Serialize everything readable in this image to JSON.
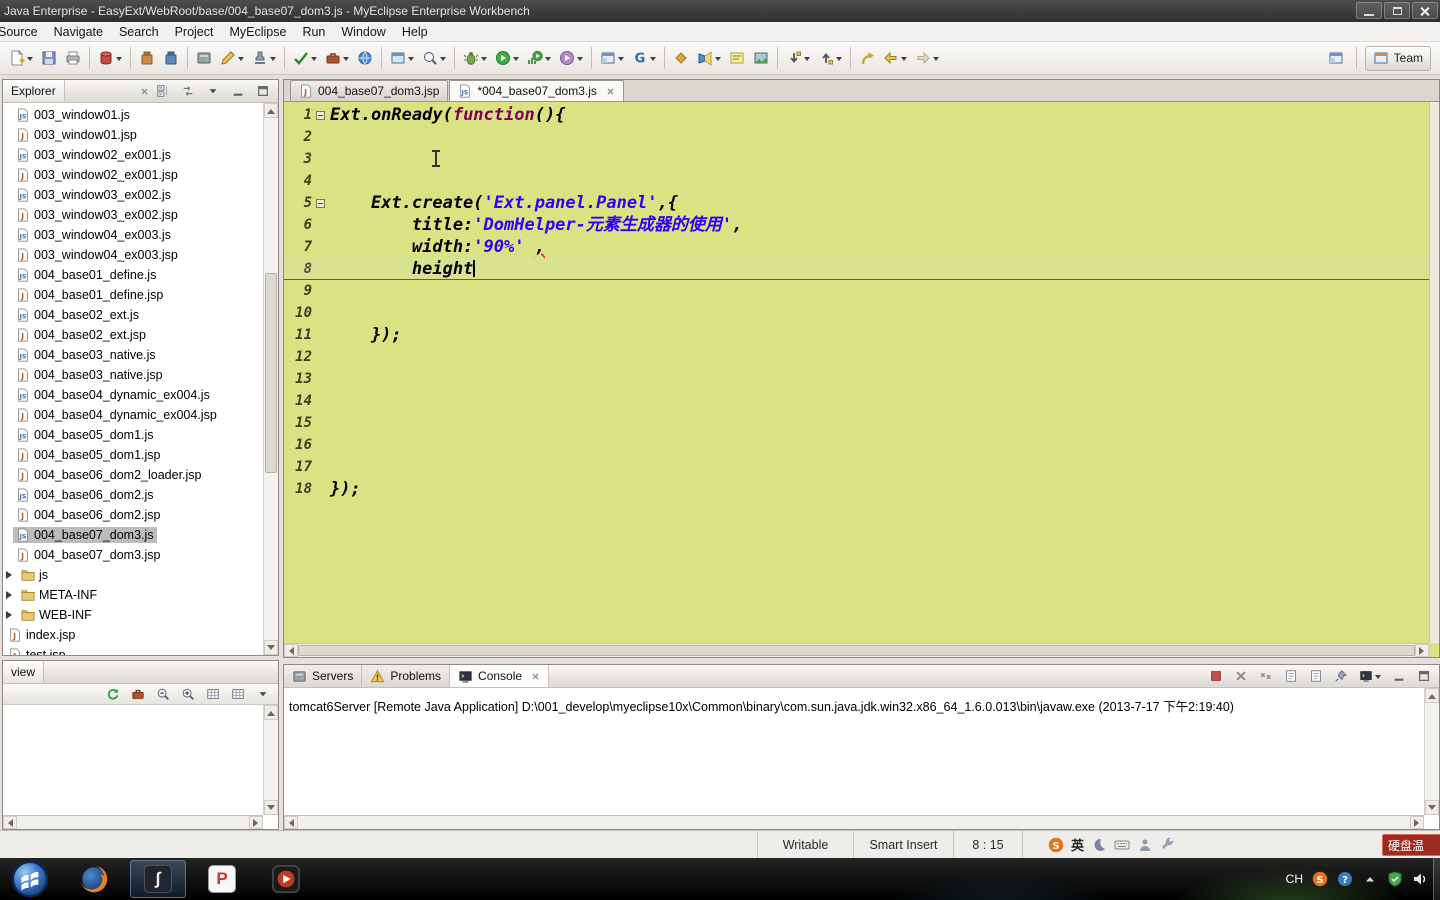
{
  "window": {
    "title": "Java Enterprise - EasyExt/WebRoot/base/004_base07_dom3.js - MyEclipse Enterprise Workbench"
  },
  "menu": {
    "items": [
      "Source",
      "Navigate",
      "Search",
      "Project",
      "MyEclipse",
      "Run",
      "Window",
      "Help"
    ]
  },
  "toolbar": {
    "perspective": {
      "team": "Team"
    },
    "groups": [
      {
        "items": [
          {
            "name": "new-wizard",
            "icon": "new",
            "dd": true
          },
          {
            "name": "save",
            "icon": "save"
          },
          {
            "name": "print",
            "icon": "print"
          }
        ]
      },
      {
        "items": [
          {
            "name": "database",
            "icon": "db",
            "dd": true
          }
        ]
      },
      {
        "items": [
          {
            "name": "deploy-jar",
            "icon": "jar"
          },
          {
            "name": "deploy-war",
            "icon": "war"
          }
        ]
      },
      {
        "items": [
          {
            "name": "run-server",
            "icon": "server"
          },
          {
            "name": "editor-pencil",
            "icon": "pencil",
            "dd": true
          },
          {
            "name": "signature",
            "icon": "stamp",
            "dd": true
          }
        ]
      },
      {
        "items": [
          {
            "name": "validate",
            "icon": "check",
            "dd": true
          },
          {
            "name": "external-tools",
            "icon": "tools",
            "dd": true
          },
          {
            "name": "web-browser",
            "icon": "globe"
          }
        ]
      },
      {
        "items": [
          {
            "name": "new-window-wizard",
            "icon": "window",
            "dd": true
          },
          {
            "name": "search-menu",
            "icon": "mag",
            "dd": true
          }
        ]
      },
      {
        "items": [
          {
            "name": "debug",
            "icon": "bug",
            "dd": true
          },
          {
            "name": "run",
            "icon": "run",
            "dd": true
          },
          {
            "name": "coverage",
            "icon": "cov",
            "dd": true
          },
          {
            "name": "profile",
            "icon": "prof",
            "dd": true
          }
        ]
      },
      {
        "items": [
          {
            "name": "new-web-project",
            "icon": "persp",
            "dd": true
          },
          {
            "name": "gwt-compile",
            "icon": "G",
            "dd": true
          }
        ]
      },
      {
        "items": [
          {
            "name": "open-type",
            "icon": "diamond"
          },
          {
            "name": "search-torch",
            "icon": "torch",
            "dd": true
          },
          {
            "name": "mark-occurrences",
            "icon": "occ"
          },
          {
            "name": "image-preview",
            "icon": "image"
          }
        ]
      },
      {
        "items": [
          {
            "name": "next-annotation",
            "icon": "an-next",
            "dd": true
          },
          {
            "name": "previous-annotation",
            "icon": "an-prev",
            "dd": true
          }
        ]
      },
      {
        "items": [
          {
            "name": "last-edit-location",
            "icon": "editloc"
          },
          {
            "name": "back",
            "icon": "back",
            "dd": true
          },
          {
            "name": "forward",
            "icon": "fwd",
            "dd": true
          }
        ]
      }
    ]
  },
  "explorer": {
    "title": "Explorer",
    "header_icons": [
      {
        "name": "collapse-all",
        "icon": "collapse"
      },
      {
        "name": "link-with-editor",
        "icon": "link"
      },
      {
        "name": "view-menu",
        "icon": "dd"
      },
      {
        "name": "minimize",
        "icon": "min"
      },
      {
        "name": "maximize",
        "icon": "max"
      }
    ],
    "items": [
      {
        "label": "003_window01.js",
        "type": "js"
      },
      {
        "label": "003_window01.jsp",
        "type": "jsp"
      },
      {
        "label": "003_window02_ex001.js",
        "type": "js"
      },
      {
        "label": "003_window02_ex001.jsp",
        "type": "jsp"
      },
      {
        "label": "003_window03_ex002.js",
        "type": "js"
      },
      {
        "label": "003_window03_ex002.jsp",
        "type": "jsp"
      },
      {
        "label": "003_window04_ex003.js",
        "type": "js"
      },
      {
        "label": "003_window04_ex003.jsp",
        "type": "jsp"
      },
      {
        "label": "004_base01_define.js",
        "type": "js"
      },
      {
        "label": "004_base01_define.jsp",
        "type": "jsp"
      },
      {
        "label": "004_base02_ext.js",
        "type": "js"
      },
      {
        "label": "004_base02_ext.jsp",
        "type": "jsp"
      },
      {
        "label": "004_base03_native.js",
        "type": "js"
      },
      {
        "label": "004_base03_native.jsp",
        "type": "jsp"
      },
      {
        "label": "004_base04_dynamic_ex004.js",
        "type": "js"
      },
      {
        "label": "004_base04_dynamic_ex004.jsp",
        "type": "jsp"
      },
      {
        "label": "004_base05_dom1.js",
        "type": "js"
      },
      {
        "label": "004_base05_dom1.jsp",
        "type": "jsp"
      },
      {
        "label": "004_base06_dom2_loader.jsp",
        "type": "jsp"
      },
      {
        "label": "004_base06_dom2.js",
        "type": "js"
      },
      {
        "label": "004_base06_dom2.jsp",
        "type": "jsp"
      },
      {
        "label": "004_base07_dom3.js",
        "type": "js",
        "selected": true
      },
      {
        "label": "004_base07_dom3.jsp",
        "type": "jsp"
      },
      {
        "label": "js",
        "type": "folder",
        "root": true
      },
      {
        "label": "META-INF",
        "type": "folder",
        "root": true
      },
      {
        "label": "WEB-INF",
        "type": "folder",
        "root": true
      },
      {
        "label": "index.jsp",
        "type": "jsp",
        "root": true
      },
      {
        "label": "test.jsp",
        "type": "jsp",
        "root": true
      }
    ]
  },
  "editor": {
    "tabs": [
      {
        "label": "004_base07_dom3.jsp",
        "type": "jsp"
      },
      {
        "label": "*004_base07_dom3.js",
        "type": "js",
        "active": true
      }
    ],
    "colors": {
      "background": "#d9e383",
      "string": "#2a00ff",
      "keyword": "#7f0055",
      "current_line": "#2f62c4"
    },
    "lines": [
      {
        "n": 1,
        "fold": true,
        "t": [
          [
            "p",
            "Ext.onReady("
          ],
          [
            "k",
            "function"
          ],
          [
            "p",
            "(){"
          ]
        ]
      },
      {
        "n": 2,
        "t": []
      },
      {
        "n": 3,
        "t": []
      },
      {
        "n": 4,
        "t": []
      },
      {
        "n": 5,
        "fold": true,
        "t": [
          [
            "p",
            "    Ext.create("
          ],
          [
            "s",
            "'Ext.panel.Panel'"
          ],
          [
            "p",
            ",{"
          ]
        ]
      },
      {
        "n": 6,
        "t": [
          [
            "p",
            "        title:"
          ],
          [
            "s",
            "'DomHelper-元素生成器的使用'"
          ],
          [
            "p",
            ","
          ]
        ]
      },
      {
        "n": 7,
        "t": [
          [
            "p",
            "        width:"
          ],
          [
            "s",
            "'90%'"
          ],
          [
            "p",
            " "
          ],
          [
            "e",
            ","
          ]
        ]
      },
      {
        "n": 8,
        "current": true,
        "cursor": true,
        "t": [
          [
            "p",
            "        height"
          ]
        ]
      },
      {
        "n": 9,
        "t": []
      },
      {
        "n": 10,
        "t": []
      },
      {
        "n": 11,
        "t": [
          [
            "p",
            "    });"
          ]
        ]
      },
      {
        "n": 12,
        "t": []
      },
      {
        "n": 13,
        "t": []
      },
      {
        "n": 14,
        "t": []
      },
      {
        "n": 15,
        "t": []
      },
      {
        "n": 16,
        "t": []
      },
      {
        "n": 17,
        "t": []
      },
      {
        "n": 18,
        "t": [
          [
            "p",
            "});"
          ]
        ]
      }
    ]
  },
  "console": {
    "tabs": [
      {
        "label": "Servers",
        "icon": "server"
      },
      {
        "label": "Problems",
        "icon": "problems"
      },
      {
        "label": "Console",
        "icon": "console",
        "active": true
      }
    ],
    "toolbar": [
      {
        "name": "terminate",
        "icon": "term"
      },
      {
        "name": "remove-launch",
        "icon": "clearx"
      },
      {
        "name": "remove-all-terminated",
        "icon": "xx"
      },
      {
        "name": "clear-console",
        "icon": "scroll"
      },
      {
        "name": "scroll-lock",
        "icon": "scroll"
      },
      {
        "name": "pin-console",
        "icon": "pin"
      },
      {
        "name": "display-selected-console",
        "icon": "console",
        "dd": true
      },
      {
        "name": "minimize",
        "icon": "min"
      },
      {
        "name": "maximize",
        "icon": "max"
      }
    ],
    "output": "tomcat6Server [Remote Java Application] D:\\001_develop\\myeclipse10x\\Common\\binary\\com.sun.java.jdk.win32.x86_64_1.6.0.013\\bin\\javaw.exe (2013-7-17 下午2:19:40)"
  },
  "preview": {
    "title": "view",
    "toolbar": [
      {
        "name": "refresh",
        "icon": "refresh"
      },
      {
        "name": "palette",
        "icon": "tools"
      },
      {
        "name": "zoom-out",
        "icon": "zoom-out"
      },
      {
        "name": "zoom-in",
        "icon": "zoom-in"
      },
      {
        "name": "table-view",
        "icon": "grid"
      },
      {
        "name": "split-view",
        "icon": "grid"
      },
      {
        "name": "view-menu",
        "icon": "dd"
      }
    ]
  },
  "statusbar": {
    "writable": "Writable",
    "insert_mode": "Smart Insert",
    "cursor_position": "8 : 15",
    "ime_lang": "英",
    "hdd_monitor": "硬盘温",
    "ime_icons": [
      {
        "name": "sogou-ime",
        "icon": "sogou"
      },
      {
        "name": "night-mode",
        "icon": "moon"
      },
      {
        "name": "soft-keyboard",
        "icon": "kbd"
      },
      {
        "name": "ime-account",
        "icon": "person"
      },
      {
        "name": "ime-settings",
        "icon": "wrench"
      }
    ]
  },
  "taskbar": {
    "apps": [
      {
        "name": "start",
        "icon": "orb"
      },
      {
        "name": "firefox",
        "icon": "firefox"
      },
      {
        "name": "editor-app",
        "glyph": "∫",
        "style": "dark",
        "pressed": true
      },
      {
        "name": "p-app",
        "glyph": "P",
        "style": "light"
      },
      {
        "name": "media-player",
        "icon": "player"
      }
    ],
    "tray": [
      {
        "name": "language",
        "text": "CH"
      },
      {
        "name": "sogou-tray",
        "icon": "sogou"
      },
      {
        "name": "help-tray",
        "icon": "help"
      },
      {
        "name": "hidden-icons",
        "icon": "up"
      },
      {
        "name": "security-tray",
        "icon": "shield"
      },
      {
        "name": "volume",
        "icon": "volume"
      }
    ]
  }
}
